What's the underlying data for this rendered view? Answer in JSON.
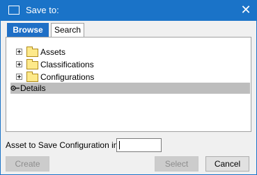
{
  "window": {
    "title": "Save to:",
    "close_glyph": "✕",
    "accent_color": "#1a73c8"
  },
  "tabs": [
    {
      "label": "Browse",
      "active": true
    },
    {
      "label": "Search",
      "active": false
    }
  ],
  "tree": {
    "items": [
      {
        "label": "Assets",
        "icon": "folder-icon",
        "expander": "plus"
      },
      {
        "label": "Classifications",
        "icon": "folder-icon",
        "expander": "plus"
      },
      {
        "label": "Configurations",
        "icon": "folder-icon",
        "expander": "plus"
      }
    ]
  },
  "details": {
    "label": "Details",
    "icon": "pin-icon"
  },
  "form": {
    "asset_label": "Asset to Save Configuration in:",
    "asset_value": ""
  },
  "buttons": {
    "create": "Create",
    "select": "Select",
    "cancel": "Cancel"
  }
}
